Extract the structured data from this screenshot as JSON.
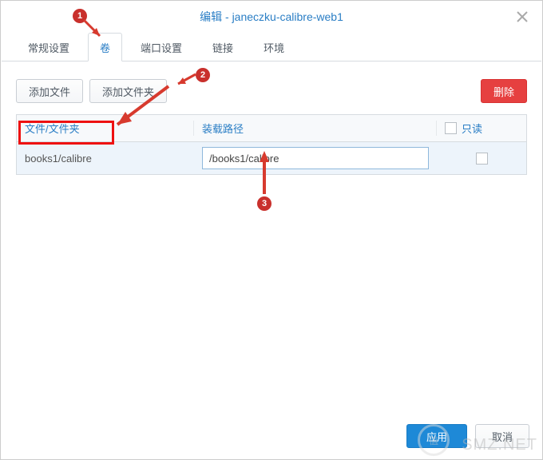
{
  "title": "编辑 - janeczku-calibre-web1",
  "tabs": [
    "常规设置",
    "卷",
    "端口设置",
    "链接",
    "环境"
  ],
  "active_tab": 1,
  "buttons": {
    "add_file": "添加文件",
    "add_folder": "添加文件夹",
    "delete": "删除",
    "apply": "应用",
    "cancel": "取消"
  },
  "headers": {
    "col1": "文件/文件夹",
    "col2": "装载路径",
    "col3": "只读"
  },
  "row": {
    "file": "books1/calibre",
    "mount": "/books1/calibre"
  },
  "watermark": "SMZ.NET"
}
